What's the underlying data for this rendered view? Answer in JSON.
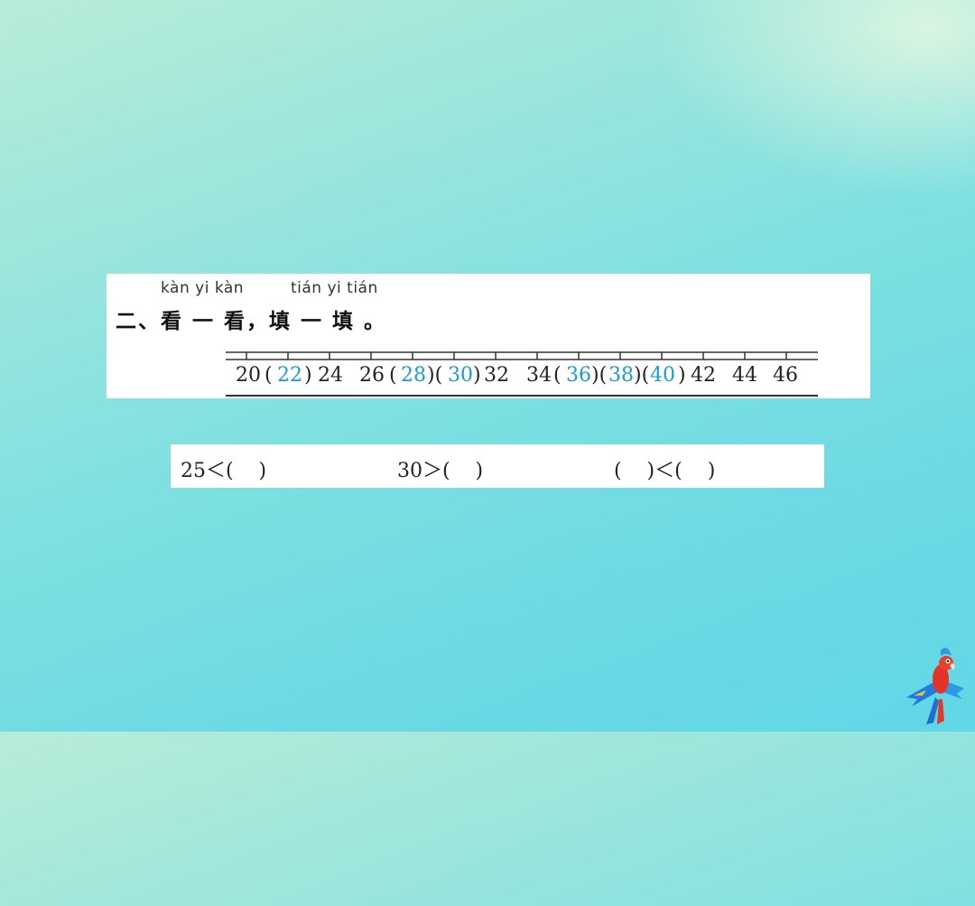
{
  "section": {
    "pinyin_1": "kàn yi kàn",
    "pinyin_2": "tián yi tián",
    "heading": "二、看 一 看，填 一 填 。"
  },
  "number_line": {
    "items": [
      {
        "text": "20",
        "answer": false
      },
      {
        "text": "(",
        "answer": false
      },
      {
        "text": "22",
        "answer": true
      },
      {
        "text": ")",
        "answer": false
      },
      {
        "text": "24",
        "answer": false
      },
      {
        "text": "26",
        "answer": false
      },
      {
        "text": "(",
        "answer": false
      },
      {
        "text": "28",
        "answer": true
      },
      {
        "text": ")(",
        "answer": false
      },
      {
        "text": "30",
        "answer": true
      },
      {
        "text": ")",
        "answer": false
      },
      {
        "text": "32",
        "answer": false
      },
      {
        "text": "34",
        "answer": false
      },
      {
        "text": "(",
        "answer": false
      },
      {
        "text": "36",
        "answer": true
      },
      {
        "text": ")(",
        "answer": false
      },
      {
        "text": "38",
        "answer": true
      },
      {
        "text": ")(",
        "answer": false
      },
      {
        "text": "40",
        "answer": true
      },
      {
        "text": ")",
        "answer": false
      },
      {
        "text": "42",
        "answer": false
      },
      {
        "text": "44",
        "answer": false
      },
      {
        "text": "46",
        "answer": false
      }
    ]
  },
  "comparisons": {
    "c1": "25＜(    )",
    "c2": "30＞(    )",
    "c3": "(    )＜(    )"
  },
  "colors": {
    "answer": "#1a9ad6"
  },
  "icons": {
    "decoration": "parrot-icon"
  }
}
